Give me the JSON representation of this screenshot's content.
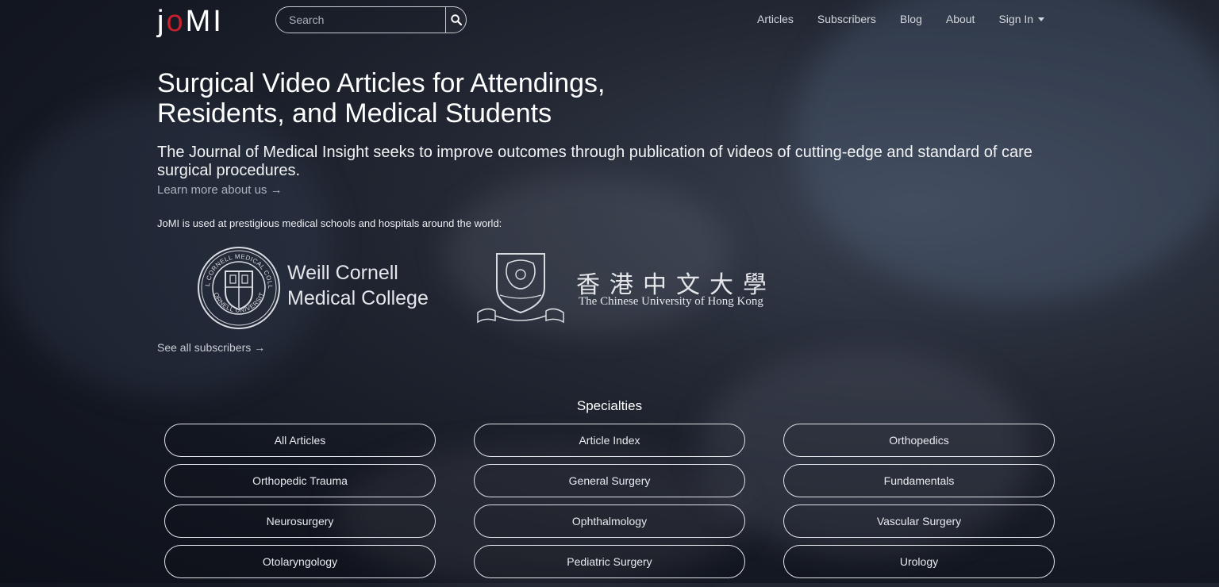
{
  "header": {
    "logo": {
      "j": "j",
      "o": "o",
      "mi": "MI"
    },
    "search": {
      "placeholder": "Search",
      "icon": "search-icon"
    },
    "nav": [
      {
        "label": "Articles"
      },
      {
        "label": "Subscribers"
      },
      {
        "label": "Blog"
      },
      {
        "label": "About"
      },
      {
        "label": "Sign In"
      }
    ]
  },
  "hero": {
    "title_line1": "Surgical Video Articles for Attendings,",
    "title_line2": "Residents, and Medical Students",
    "lead": "The Journal of Medical Insight seeks to improve outcomes through publication of videos of cutting-edge and standard of care surgical procedures.",
    "learn_more": "Learn more about us →",
    "used_at": "JoMI is used at prestigious medical schools and hospitals around the world:"
  },
  "institutions": {
    "weill": {
      "line1": "Weill Cornell",
      "line2": "Medical College",
      "seal_top": "WEILL CORNELL MEDICAL COLLEGE",
      "seal_bottom": "CORNELL UNIVERSITY"
    },
    "cuhk": {
      "chinese": "香港中文大學",
      "english": "The Chinese University of Hong Kong"
    },
    "see_all": "See all subscribers →"
  },
  "specialties": {
    "title": "Specialties",
    "items": [
      "All Articles",
      "Article Index",
      "Orthopedics",
      "Orthopedic Trauma",
      "General Surgery",
      "Fundamentals",
      "Neurosurgery",
      "Ophthalmology",
      "Vascular Surgery",
      "Otolaryngology",
      "Pediatric Surgery",
      "Urology"
    ]
  },
  "colors": {
    "accent": "#c8202c",
    "background": "#1a1e28"
  }
}
